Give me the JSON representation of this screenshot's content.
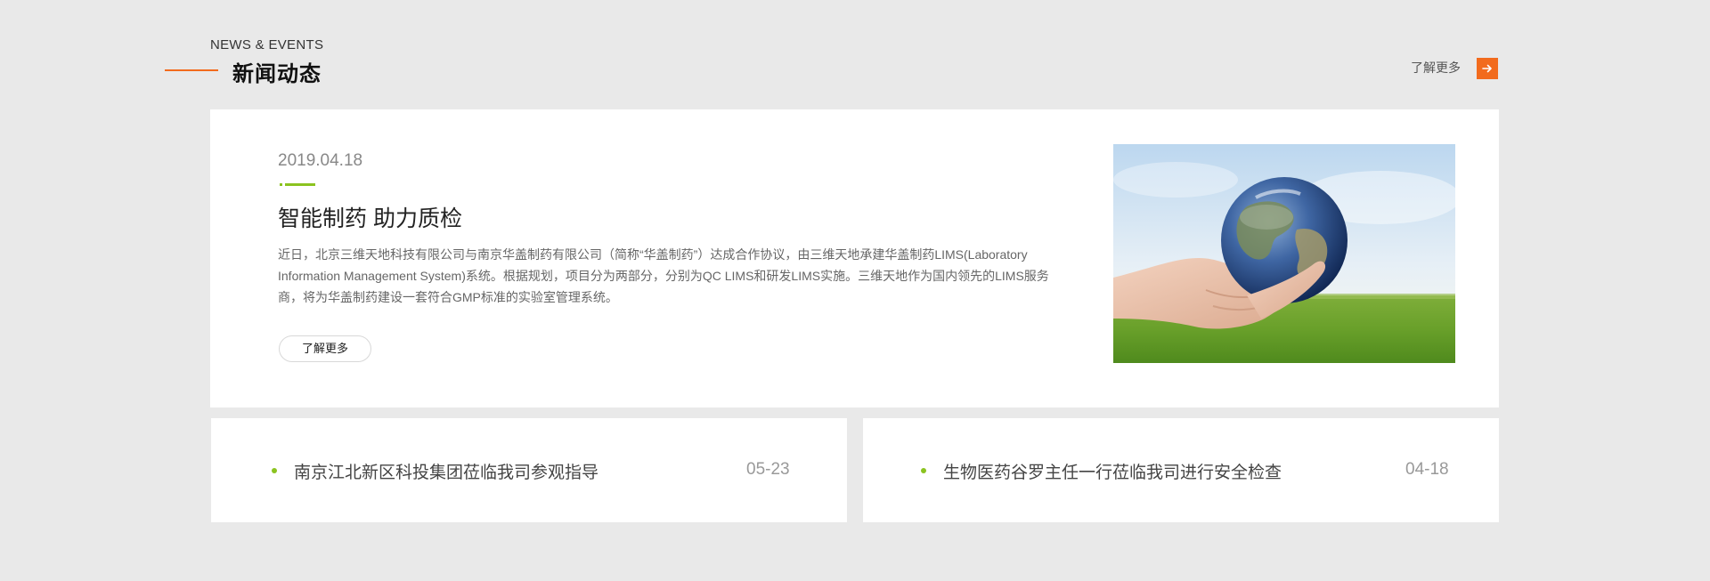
{
  "section": {
    "title_en": "NEWS & EVENTS",
    "title_cn": "新闻动态",
    "more_label": "了解更多",
    "accent_color": "#f26b1d"
  },
  "feature": {
    "date": "2019.04.18",
    "title": "智能制药 助力质检",
    "summary": "近日，北京三维天地科技有限公司与南京华盖制药有限公司（简称“华盖制药”）达成合作协议，由三维天地承建华盖制药LIMS(Laboratory Information Management System)系统。根据规划，项目分为两部分，分别为QC LIMS和研发LIMS实施。三维天地作为国内领先的LIMS服务商，将为华盖制药建设一套符合GMP标准的实验室管理系统。",
    "more_label": "了解更多",
    "accent_color": "#8bc320",
    "image_icon": "earth-in-hands-photo"
  },
  "news": [
    {
      "title": "南京江北新区科投集团莅临我司参观指导",
      "date": "05-23"
    },
    {
      "title": "生物医药谷罗主任一行莅临我司进行安全检查",
      "date": "04-18"
    }
  ]
}
